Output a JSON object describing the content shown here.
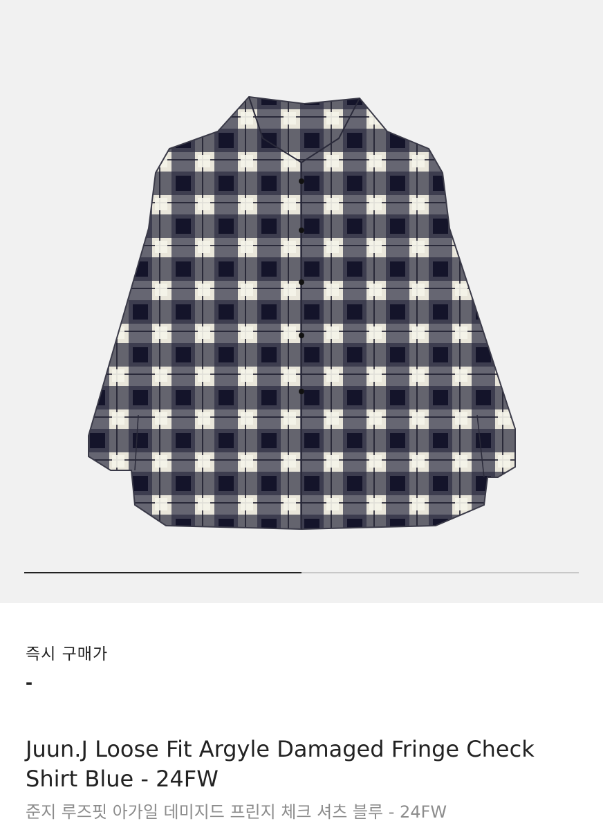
{
  "product": {
    "image_alt": "plaid shirt product photo",
    "image_progress": 0.5
  },
  "price": {
    "label": "즉시 구매가",
    "value": "-"
  },
  "title": "Juun.J Loose Fit Argyle Damaged Fringe Check Shirt Blue - 24FW",
  "subtitle": "준지 루즈핏 아가일 데미지드 프린지 체크 셔츠 블루 - 24FW"
}
